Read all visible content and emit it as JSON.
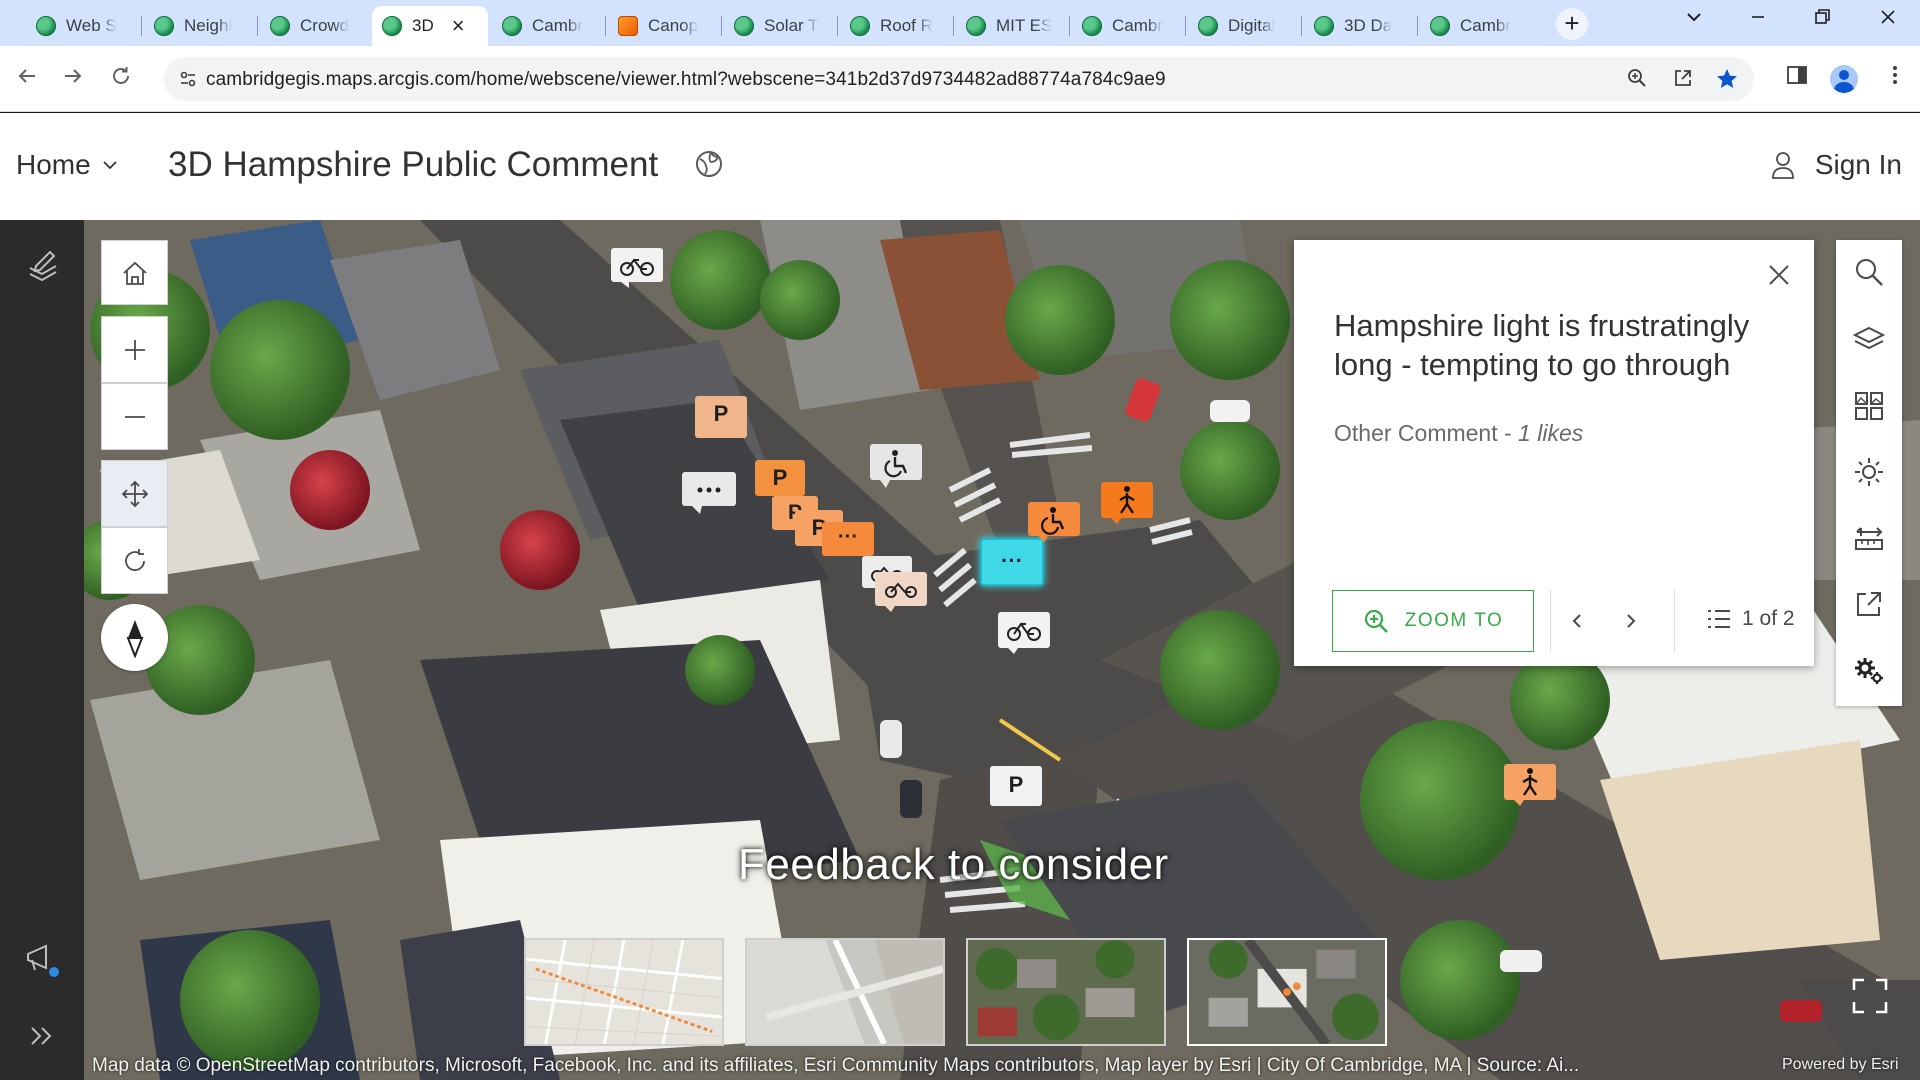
{
  "browser": {
    "tabs": [
      {
        "label": "Web S",
        "favicon": "globe-icon"
      },
      {
        "label": "Neighl",
        "favicon": "globe-icon"
      },
      {
        "label": "Crowd",
        "favicon": "globe-icon"
      },
      {
        "label": "3D",
        "favicon": "globe-icon",
        "active": true
      },
      {
        "label": "Cambr",
        "favicon": "globe-icon"
      },
      {
        "label": "Canop",
        "favicon": "app-icon"
      },
      {
        "label": "Solar T",
        "favicon": "globe-icon"
      },
      {
        "label": "Roof R",
        "favicon": "globe-icon"
      },
      {
        "label": "MIT ES",
        "favicon": "globe-icon"
      },
      {
        "label": "Cambr",
        "favicon": "globe-icon"
      },
      {
        "label": "Digital",
        "favicon": "globe-icon"
      },
      {
        "label": "3D Da",
        "favicon": "globe-icon"
      },
      {
        "label": "Cambr",
        "favicon": "globe-icon"
      }
    ],
    "close_tab_glyph": "×",
    "new_tab_glyph": "+",
    "url": "cambridgegis.maps.arcgis.com/home/webscene/viewer.html?webscene=341b2d37d9734482ad88774a784c9ae9"
  },
  "header": {
    "home_label": "Home",
    "title": "3D Hampshire Public Comment",
    "sign_in_label": "Sign In"
  },
  "popup": {
    "title": "Hampshire light is frustratingly long - tempting to go through",
    "category": "Other Comment - ",
    "likes": "1  likes",
    "zoom_label": "ZOOM TO",
    "count": "1 of 2"
  },
  "map": {
    "caption": "Feedback to consider",
    "attribution": "Map data © OpenStreetMap contributors, Microsoft, Facebook, Inc. and its affiliates, Esri Community Maps contributors, Map layer by Esri | City Of Cambridge, MA | Source: Ai...",
    "powered_by": "Powered by Esri",
    "markers": [
      {
        "label": "P",
        "type": "parking"
      },
      {
        "label": "P",
        "type": "parking"
      },
      {
        "label": "P",
        "type": "parking"
      },
      {
        "label": "P",
        "type": "parking"
      },
      {
        "label": "P",
        "type": "parking"
      },
      {
        "label": "···",
        "type": "comment"
      },
      {
        "label": "···",
        "type": "comment"
      },
      {
        "label": "···",
        "type": "comment"
      }
    ]
  },
  "colors": {
    "accent_green": "#35ac46",
    "marker_orange": "#f58a3c",
    "marker_selected": "#3fd9e8",
    "left_panel": "#2b2b2b",
    "tabstrip": "#d3e3fd"
  }
}
